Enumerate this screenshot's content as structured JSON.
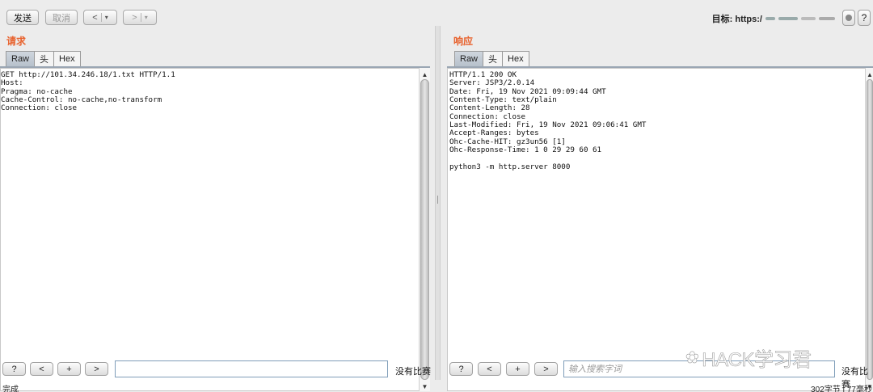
{
  "toolbar": {
    "send_label": "发送",
    "cancel_label": "取消",
    "back_label": "<",
    "forward_label": ">",
    "dropdown_glyph": "▾",
    "target_label": "目标: https:/",
    "help_label": "?"
  },
  "request": {
    "title": "请求",
    "tabs": [
      "Raw",
      "头",
      "Hex"
    ],
    "lines": [
      "GET http://101.34.246.18/1.txt HTTP/1.1",
      "Host: ",
      "Pragma: no-cache",
      "Cache-Control: no-cache,no-transform",
      "Connection: close"
    ],
    "search": {
      "value": "",
      "placeholder": "",
      "no_match": "没有比赛"
    }
  },
  "response": {
    "title": "响应",
    "tabs": [
      "Raw",
      "头",
      "Hex"
    ],
    "lines": [
      "HTTP/1.1 200 OK",
      "Server: JSP3/2.0.14",
      "Date: Fri, 19 Nov 2021 09:09:44 GMT",
      "Content-Type: text/plain",
      "Content-Length: 28",
      "Connection: close",
      "Last-Modified: Fri, 19 Nov 2021 09:06:41 GMT",
      "Accept-Ranges: bytes",
      "Ohc-Cache-HIT: gz3un56 [1]",
      "Ohc-Response-Time: 1 0 29 29 60 61",
      "",
      "python3 -m http.server 8000"
    ],
    "search": {
      "value": "",
      "placeholder": "输入搜索字词",
      "no_match": "没有比赛"
    }
  },
  "search_buttons": [
    "?",
    "<",
    "+",
    ">"
  ],
  "status": {
    "left": "完成",
    "right": "302字节 | 77毫秒"
  },
  "watermark": "HACK学习君"
}
